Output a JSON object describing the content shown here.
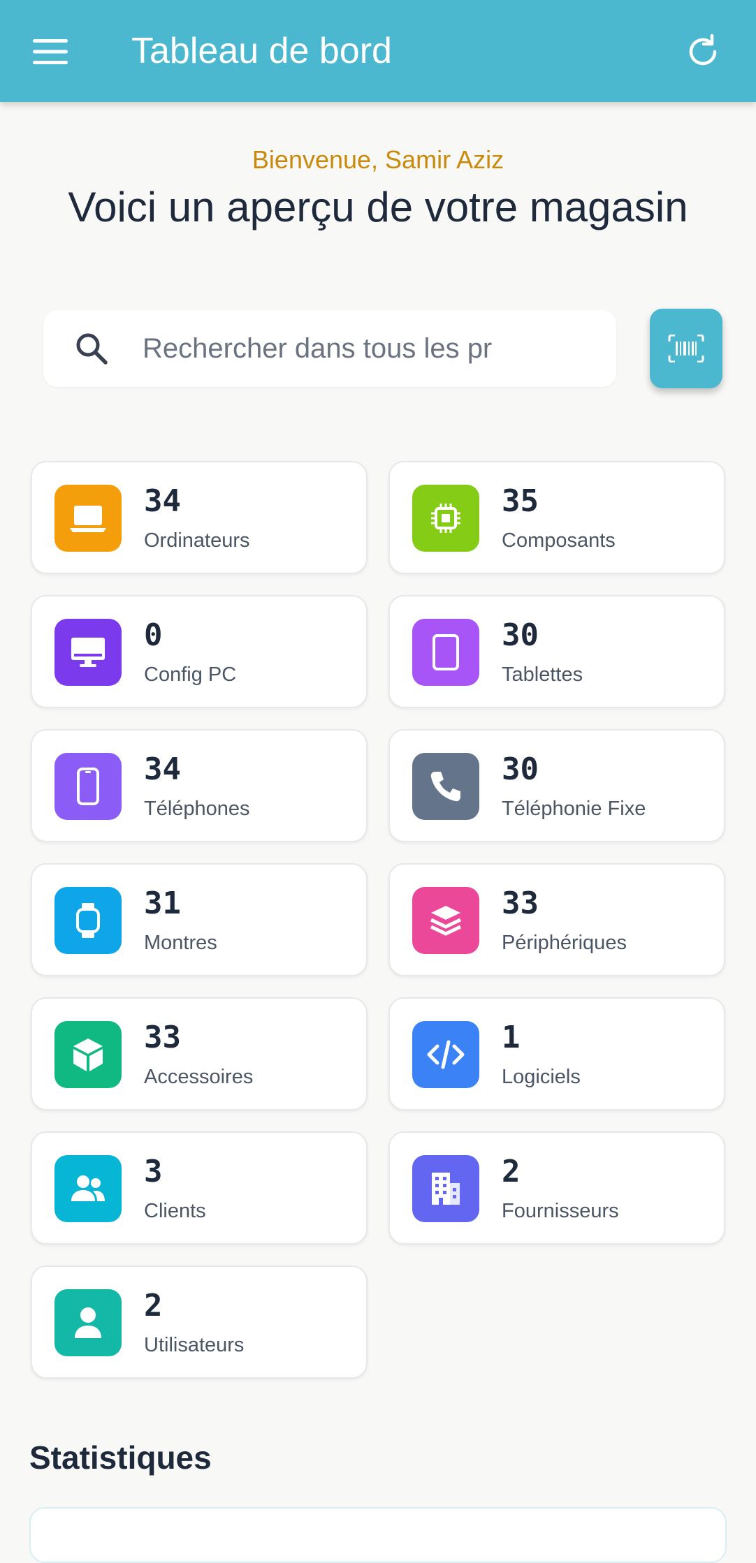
{
  "appbar": {
    "title": "Tableau de bord",
    "menu_icon": "menu-icon",
    "refresh_icon": "refresh-icon"
  },
  "header": {
    "welcome": "Bienvenue, Samir Aziz",
    "subtitle": "Voici un aperçu de votre magasin"
  },
  "search": {
    "placeholder": "Rechercher dans tous les pr",
    "value": ""
  },
  "scan_button": {
    "icon": "barcode-scan-icon"
  },
  "colors": {
    "primary": "#4bb8d0",
    "welcome": "#c98a0b",
    "ordinateurs": "#f59e0b",
    "composants": "#84cc16",
    "config_pc": "#7c3aed",
    "tablettes": "#a855f7",
    "telephones": "#8b5cf6",
    "telephonie_fixe": "#64748b",
    "montres": "#0ea5e9",
    "peripheriques": "#ec4899",
    "accessoires": "#10b981",
    "logiciels": "#3b82f6",
    "clients": "#06b6d4",
    "fournisseurs": "#6366f1",
    "utilisateurs": "#14b8a6"
  },
  "cards": [
    {
      "count": "34",
      "label": "Ordinateurs",
      "icon": "laptop-icon"
    },
    {
      "count": "35",
      "label": "Composants",
      "icon": "chip-icon"
    },
    {
      "count": "0",
      "label": "Config PC",
      "icon": "desktop-icon"
    },
    {
      "count": "30",
      "label": "Tablettes",
      "icon": "tablet-icon"
    },
    {
      "count": "34",
      "label": "Téléphones",
      "icon": "smartphone-icon"
    },
    {
      "count": "30",
      "label": "Téléphonie Fixe",
      "icon": "phone-icon"
    },
    {
      "count": "31",
      "label": "Montres",
      "icon": "watch-icon"
    },
    {
      "count": "33",
      "label": "Périphériques",
      "icon": "layers-icon"
    },
    {
      "count": "33",
      "label": "Accessoires",
      "icon": "box-icon"
    },
    {
      "count": "1",
      "label": "Logiciels",
      "icon": "code-icon"
    },
    {
      "count": "3",
      "label": "Clients",
      "icon": "users-icon"
    },
    {
      "count": "2",
      "label": "Fournisseurs",
      "icon": "building-icon"
    },
    {
      "count": "2",
      "label": "Utilisateurs",
      "icon": "user-icon"
    }
  ],
  "stats": {
    "title": "Statistiques"
  }
}
